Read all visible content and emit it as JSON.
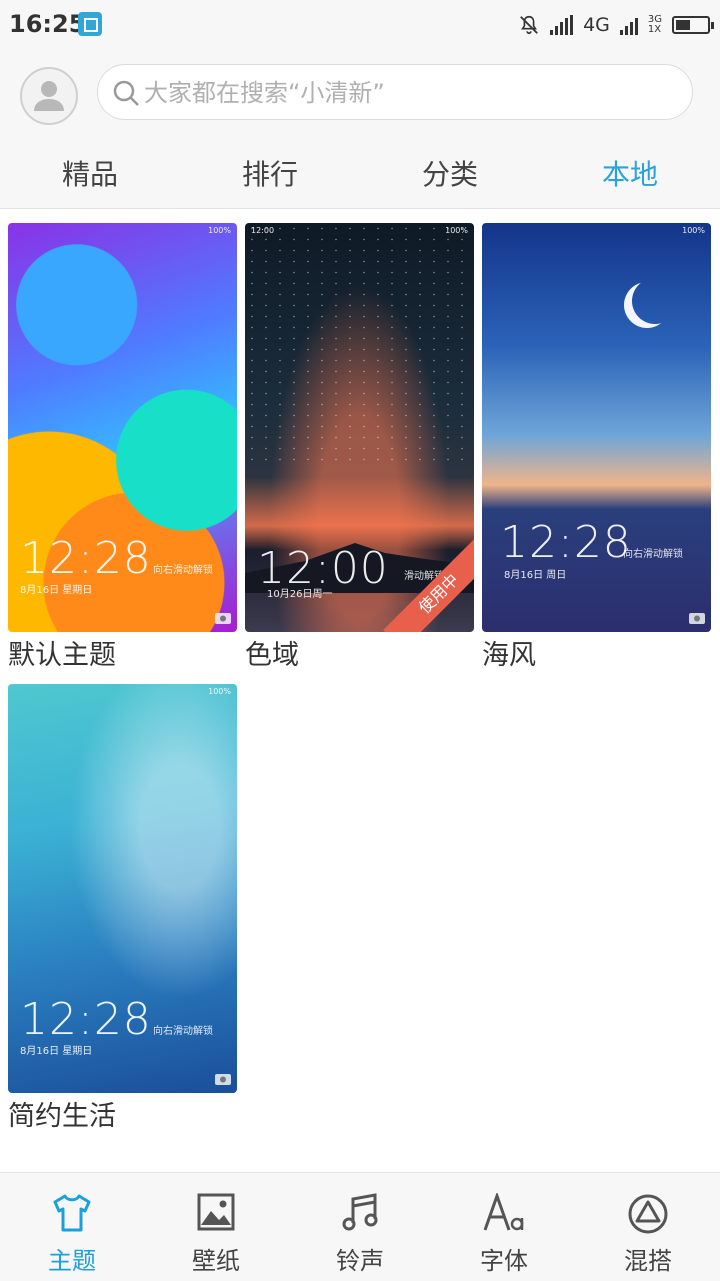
{
  "status_bar": {
    "time": "16:25",
    "network": "4G",
    "network2_top": "3G",
    "network2_bottom": "1X",
    "battery_level": 0.45
  },
  "header": {
    "search_placeholder": "大家都在搜索“小清新”",
    "tabs": [
      {
        "label": "精品",
        "active": false
      },
      {
        "label": "排行",
        "active": false
      },
      {
        "label": "分类",
        "active": false
      },
      {
        "label": "本地",
        "active": true
      }
    ]
  },
  "themes": [
    {
      "title": "默认主题",
      "lock_time": "12:28",
      "lock_date": "8月16日  星期日",
      "hint": "向右滑动解锁",
      "mini_status": "100%"
    },
    {
      "title": "色域",
      "lock_time": "12:00",
      "lock_date": "10月26日周一",
      "hint": "滑动解锁",
      "mini_status": "100%",
      "mini_time": "12:00",
      "badge": "使用中"
    },
    {
      "title": "海风",
      "lock_time": "12:28",
      "lock_date": "8月16日 周日",
      "hint": "向右滑动解锁",
      "mini_status": "100%"
    },
    {
      "title": "简约生活",
      "lock_time": "12:28",
      "lock_date": "8月16日  星期日",
      "hint": "向右滑动解锁",
      "mini_status": "100%"
    }
  ],
  "bottom_nav": [
    {
      "label": "主题",
      "icon": "tshirt-icon",
      "active": true
    },
    {
      "label": "壁纸",
      "icon": "image-icon",
      "active": false
    },
    {
      "label": "铃声",
      "icon": "music-note-icon",
      "active": false
    },
    {
      "label": "字体",
      "icon": "font-icon",
      "active": false
    },
    {
      "label": "混搭",
      "icon": "triangle-circle-icon",
      "active": false
    }
  ],
  "colors": {
    "accent": "#29a3d9",
    "badge": "#e8604c"
  }
}
